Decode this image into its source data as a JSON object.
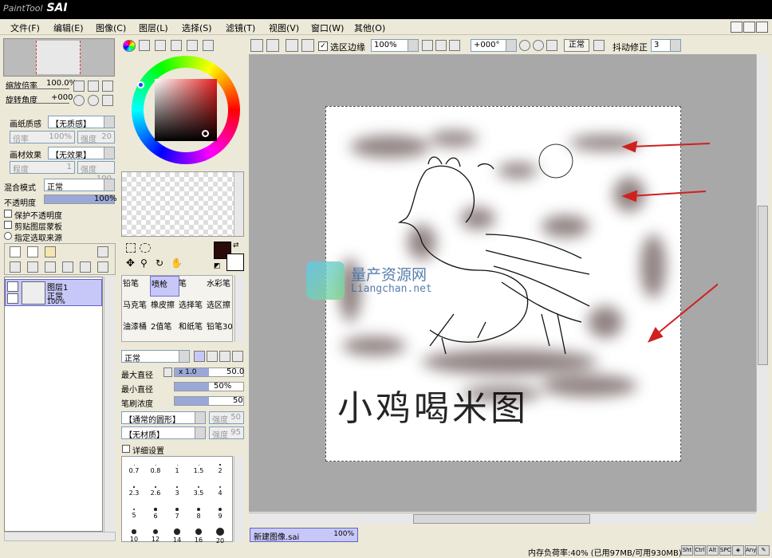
{
  "app": {
    "logo": "SAI",
    "logo_prefix": "PaintTool"
  },
  "menu": [
    "文件(F)",
    "编辑(E)",
    "图像(C)",
    "图层(L)",
    "选择(S)",
    "滤镜(T)",
    "视图(V)",
    "窗口(W)",
    "其他(O)"
  ],
  "navigator": {
    "zoom_label": "缩放倍率",
    "zoom_value": "100.0%",
    "rotate_label": "旋转角度",
    "rotate_value": "+000"
  },
  "paper": {
    "texture_label": "画纸质感",
    "texture_value": "【无质感】",
    "scale_label": "倍率",
    "scale_value": "100%",
    "strength_label": "强度",
    "strength_value": "20",
    "effect_label": "画材效果",
    "effect_value": "【无效果】",
    "degree_label": "程度",
    "degree_value": "1",
    "strength2_value": "100"
  },
  "layer_props": {
    "blend_label": "混合模式",
    "blend_value": "正常",
    "opacity_label": "不透明度",
    "opacity_value": "100%",
    "protect_label": "保护不透明度",
    "clip_label": "剪贴图层蒙板",
    "source_label": "指定选取来源"
  },
  "layer": {
    "name": "图层1",
    "mode": "正常",
    "opacity": "100%"
  },
  "tools": [
    [
      "铅笔",
      "喷枪",
      "笔",
      "水彩笔"
    ],
    [
      "马克笔",
      "橡皮擦",
      "选择笔",
      "选区擦"
    ],
    [
      "油漆桶",
      "2值笔",
      "和纸笔",
      "铅笔30"
    ]
  ],
  "brush": {
    "mode": "正常",
    "max_label": "最大直径",
    "max_mult": "x 1.0",
    "max_value": "50.0",
    "min_label": "最小直径",
    "min_value": "50%",
    "density_label": "笔刷浓度",
    "density_value": "50",
    "shape": "【通常的圆形】",
    "shape_strength_label": "强度",
    "shape_strength": "50",
    "texture": "【无材质】",
    "texture_strength_label": "强度",
    "texture_strength": "95",
    "detail_label": "详细设置"
  },
  "brush_sizes": [
    "0.7",
    "0.8",
    "1",
    "1.5",
    "2",
    "2.3",
    "2.6",
    "3",
    "3.5",
    "4",
    "5",
    "6",
    "7",
    "8",
    "9"
  ],
  "brush_sizes_partial": [
    "10",
    "12",
    "14",
    "16",
    "20"
  ],
  "toolbar": {
    "selection_edge": "选区边缘",
    "zoom": "100%",
    "angle": "+000°",
    "mode": "正常",
    "stabilizer_label": "抖动修正",
    "stabilizer_value": "3"
  },
  "watermark": {
    "title": "量产资源网",
    "url": "Liangchan.net"
  },
  "drawing_text": "小鸡喝米图",
  "tab": {
    "name": "新建图像.sai",
    "zoom": "100%"
  },
  "status": {
    "memory": "内存负荷率:40% (已用97MB/可用930MB)",
    "keys": [
      "Sht",
      "Ctrl",
      "Alt",
      "SPC",
      "Any"
    ]
  },
  "colors": {
    "primary": "#2a0a0a",
    "accent": "#d02020",
    "selected": "#c8c8f8"
  }
}
